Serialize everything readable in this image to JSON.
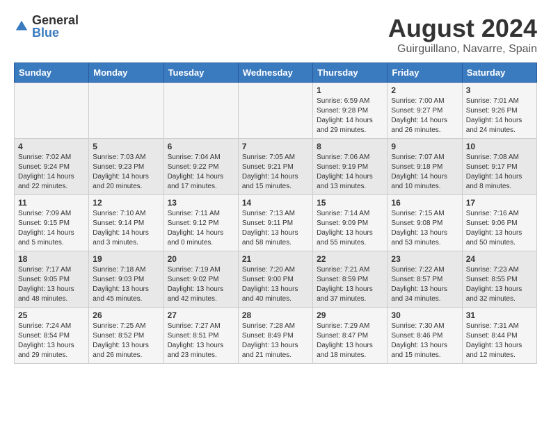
{
  "header": {
    "logo_general": "General",
    "logo_blue": "Blue",
    "title": "August 2024",
    "subtitle": "Guirguillano, Navarre, Spain"
  },
  "days_of_week": [
    "Sunday",
    "Monday",
    "Tuesday",
    "Wednesday",
    "Thursday",
    "Friday",
    "Saturday"
  ],
  "weeks": [
    [
      {
        "day": "",
        "info": ""
      },
      {
        "day": "",
        "info": ""
      },
      {
        "day": "",
        "info": ""
      },
      {
        "day": "",
        "info": ""
      },
      {
        "day": "1",
        "info": "Sunrise: 6:59 AM\nSunset: 9:28 PM\nDaylight: 14 hours\nand 29 minutes."
      },
      {
        "day": "2",
        "info": "Sunrise: 7:00 AM\nSunset: 9:27 PM\nDaylight: 14 hours\nand 26 minutes."
      },
      {
        "day": "3",
        "info": "Sunrise: 7:01 AM\nSunset: 9:26 PM\nDaylight: 14 hours\nand 24 minutes."
      }
    ],
    [
      {
        "day": "4",
        "info": "Sunrise: 7:02 AM\nSunset: 9:24 PM\nDaylight: 14 hours\nand 22 minutes."
      },
      {
        "day": "5",
        "info": "Sunrise: 7:03 AM\nSunset: 9:23 PM\nDaylight: 14 hours\nand 20 minutes."
      },
      {
        "day": "6",
        "info": "Sunrise: 7:04 AM\nSunset: 9:22 PM\nDaylight: 14 hours\nand 17 minutes."
      },
      {
        "day": "7",
        "info": "Sunrise: 7:05 AM\nSunset: 9:21 PM\nDaylight: 14 hours\nand 15 minutes."
      },
      {
        "day": "8",
        "info": "Sunrise: 7:06 AM\nSunset: 9:19 PM\nDaylight: 14 hours\nand 13 minutes."
      },
      {
        "day": "9",
        "info": "Sunrise: 7:07 AM\nSunset: 9:18 PM\nDaylight: 14 hours\nand 10 minutes."
      },
      {
        "day": "10",
        "info": "Sunrise: 7:08 AM\nSunset: 9:17 PM\nDaylight: 14 hours\nand 8 minutes."
      }
    ],
    [
      {
        "day": "11",
        "info": "Sunrise: 7:09 AM\nSunset: 9:15 PM\nDaylight: 14 hours\nand 5 minutes."
      },
      {
        "day": "12",
        "info": "Sunrise: 7:10 AM\nSunset: 9:14 PM\nDaylight: 14 hours\nand 3 minutes."
      },
      {
        "day": "13",
        "info": "Sunrise: 7:11 AM\nSunset: 9:12 PM\nDaylight: 14 hours\nand 0 minutes."
      },
      {
        "day": "14",
        "info": "Sunrise: 7:13 AM\nSunset: 9:11 PM\nDaylight: 13 hours\nand 58 minutes."
      },
      {
        "day": "15",
        "info": "Sunrise: 7:14 AM\nSunset: 9:09 PM\nDaylight: 13 hours\nand 55 minutes."
      },
      {
        "day": "16",
        "info": "Sunrise: 7:15 AM\nSunset: 9:08 PM\nDaylight: 13 hours\nand 53 minutes."
      },
      {
        "day": "17",
        "info": "Sunrise: 7:16 AM\nSunset: 9:06 PM\nDaylight: 13 hours\nand 50 minutes."
      }
    ],
    [
      {
        "day": "18",
        "info": "Sunrise: 7:17 AM\nSunset: 9:05 PM\nDaylight: 13 hours\nand 48 minutes."
      },
      {
        "day": "19",
        "info": "Sunrise: 7:18 AM\nSunset: 9:03 PM\nDaylight: 13 hours\nand 45 minutes."
      },
      {
        "day": "20",
        "info": "Sunrise: 7:19 AM\nSunset: 9:02 PM\nDaylight: 13 hours\nand 42 minutes."
      },
      {
        "day": "21",
        "info": "Sunrise: 7:20 AM\nSunset: 9:00 PM\nDaylight: 13 hours\nand 40 minutes."
      },
      {
        "day": "22",
        "info": "Sunrise: 7:21 AM\nSunset: 8:59 PM\nDaylight: 13 hours\nand 37 minutes."
      },
      {
        "day": "23",
        "info": "Sunrise: 7:22 AM\nSunset: 8:57 PM\nDaylight: 13 hours\nand 34 minutes."
      },
      {
        "day": "24",
        "info": "Sunrise: 7:23 AM\nSunset: 8:55 PM\nDaylight: 13 hours\nand 32 minutes."
      }
    ],
    [
      {
        "day": "25",
        "info": "Sunrise: 7:24 AM\nSunset: 8:54 PM\nDaylight: 13 hours\nand 29 minutes."
      },
      {
        "day": "26",
        "info": "Sunrise: 7:25 AM\nSunset: 8:52 PM\nDaylight: 13 hours\nand 26 minutes."
      },
      {
        "day": "27",
        "info": "Sunrise: 7:27 AM\nSunset: 8:51 PM\nDaylight: 13 hours\nand 23 minutes."
      },
      {
        "day": "28",
        "info": "Sunrise: 7:28 AM\nSunset: 8:49 PM\nDaylight: 13 hours\nand 21 minutes."
      },
      {
        "day": "29",
        "info": "Sunrise: 7:29 AM\nSunset: 8:47 PM\nDaylight: 13 hours\nand 18 minutes."
      },
      {
        "day": "30",
        "info": "Sunrise: 7:30 AM\nSunset: 8:46 PM\nDaylight: 13 hours\nand 15 minutes."
      },
      {
        "day": "31",
        "info": "Sunrise: 7:31 AM\nSunset: 8:44 PM\nDaylight: 13 hours\nand 12 minutes."
      }
    ]
  ]
}
